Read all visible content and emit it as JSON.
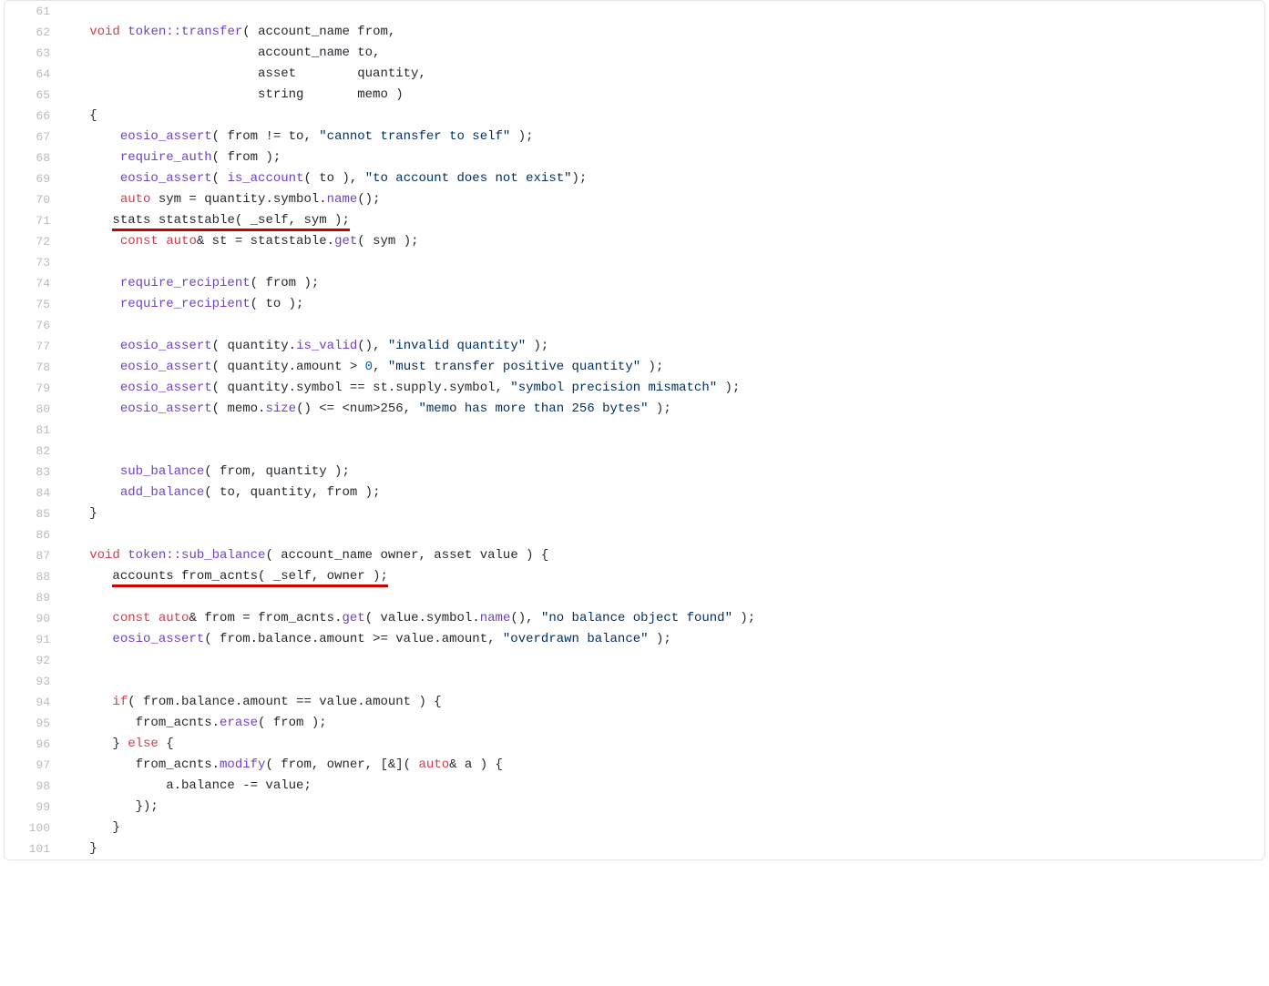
{
  "colors": {
    "keyword": "#d73a49",
    "function": "#6f42c1",
    "type": "#005cc5",
    "number": "#005cc5",
    "string": "#032f62",
    "text": "#24292e",
    "lineno": "#babbbc",
    "underline": "#cc0000"
  },
  "lines": [
    {
      "n": "61",
      "t": "",
      "ul": false
    },
    {
      "n": "62",
      "t": "   <kw>void</kw> <fn>token::transfer</fn>( account_name from,",
      "ul": false
    },
    {
      "n": "63",
      "t": "                         account_name to,",
      "ul": false
    },
    {
      "n": "64",
      "t": "                         asset        quantity,",
      "ul": false
    },
    {
      "n": "65",
      "t": "                         string       memo )",
      "ul": false
    },
    {
      "n": "66",
      "t": "   {",
      "ul": false
    },
    {
      "n": "67",
      "t": "       <fn>eosio_assert</fn>( from != to, <str>\"cannot transfer to self\"</str> );",
      "ul": false
    },
    {
      "n": "68",
      "t": "       <fn>require_auth</fn>( from );",
      "ul": false
    },
    {
      "n": "69",
      "t": "       <fn>eosio_assert</fn>( <fn>is_account</fn>( to ), <str>\"to account does not exist\"</str>);",
      "ul": false
    },
    {
      "n": "70",
      "t": "       <kw>auto</kw> sym = quantity.symbol.<fn>name</fn>();",
      "ul": false
    },
    {
      "n": "71",
      "t": "      <ul>stats statstable( _self, sym );</ul>",
      "ul": true
    },
    {
      "n": "72",
      "t": "       <kw>const</kw> <kw>auto</kw>& st = statstable.<fn>get</fn>( sym );",
      "ul": false
    },
    {
      "n": "73",
      "t": "",
      "ul": false
    },
    {
      "n": "74",
      "t": "       <fn>require_recipient</fn>( from );",
      "ul": false
    },
    {
      "n": "75",
      "t": "       <fn>require_recipient</fn>( to );",
      "ul": false
    },
    {
      "n": "76",
      "t": "",
      "ul": false
    },
    {
      "n": "77",
      "t": "       <fn>eosio_assert</fn>( quantity.<fn>is_valid</fn>(), <str>\"invalid quantity\"</str> );",
      "ul": false
    },
    {
      "n": "78",
      "t": "       <fn>eosio_assert</fn>( quantity.amount > <num>0</num>, <str>\"must transfer positive quantity\"</str> );",
      "ul": false
    },
    {
      "n": "79",
      "t": "       <fn>eosio_assert</fn>( quantity.symbol == st.supply.symbol, <str>\"symbol precision mismatch\"</str> );",
      "ul": false
    },
    {
      "n": "80",
      "t": "       <fn>eosio_assert</fn>( memo.<fn>size</fn>() <= <num>256</num>, <str>\"memo has more than 256 bytes\"</str> );",
      "ul": false
    },
    {
      "n": "81",
      "t": "",
      "ul": false
    },
    {
      "n": "82",
      "t": "",
      "ul": false
    },
    {
      "n": "83",
      "t": "       <fn>sub_balance</fn>( from, quantity );",
      "ul": false
    },
    {
      "n": "84",
      "t": "       <fn>add_balance</fn>( to, quantity, from );",
      "ul": false
    },
    {
      "n": "85",
      "t": "   }",
      "ul": false
    },
    {
      "n": "86",
      "t": "",
      "ul": false
    },
    {
      "n": "87",
      "t": "   <kw>void</kw> <fn>token::sub_balance</fn>( account_name owner, asset value ) {",
      "ul": false
    },
    {
      "n": "88",
      "t": "      <ul>accounts from_acnts( _self, owner );</ul>",
      "ul": true
    },
    {
      "n": "89",
      "t": "",
      "ul": false
    },
    {
      "n": "90",
      "t": "      <kw>const</kw> <kw>auto</kw>& from = from_acnts.<fn>get</fn>( value.symbol.<fn>name</fn>(), <str>\"no balance object found\"</str> );",
      "ul": false
    },
    {
      "n": "91",
      "t": "      <fn>eosio_assert</fn>( from.balance.amount >= value.amount, <str>\"overdrawn balance\"</str> );",
      "ul": false
    },
    {
      "n": "92",
      "t": "",
      "ul": false
    },
    {
      "n": "93",
      "t": "",
      "ul": false
    },
    {
      "n": "94",
      "t": "      <kw>if</kw>( from.balance.amount == value.amount ) {",
      "ul": false
    },
    {
      "n": "95",
      "t": "         from_acnts.<fn>erase</fn>( from );",
      "ul": false
    },
    {
      "n": "96",
      "t": "      } <kw>else</kw> {",
      "ul": false
    },
    {
      "n": "97",
      "t": "         from_acnts.<fn>modify</fn>( from, owner, [&]( <kw>auto</kw>& a ) {",
      "ul": false
    },
    {
      "n": "98",
      "t": "             a.balance -= value;",
      "ul": false
    },
    {
      "n": "99",
      "t": "         });",
      "ul": false
    },
    {
      "n": "100",
      "t": "      }",
      "ul": false
    },
    {
      "n": "101",
      "t": "   }",
      "ul": false
    }
  ]
}
